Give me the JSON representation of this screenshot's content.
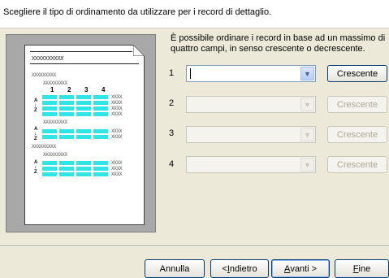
{
  "header": {
    "instruction": "Scegliere il tipo di ordinamento da utilizzare per i record di dettaglio."
  },
  "description": "È possibile ordinare i record in base ad un massimo di quattro campi, in senso crescente o decrescente.",
  "preview": {
    "placeholder_long": "XXXXXXXXXX",
    "placeholder_mid": "XXXXXXXXX",
    "placeholder_short": "XXXXXX",
    "cell_text": "XXXX",
    "column_numbers": [
      "1",
      "2",
      "3",
      "4"
    ],
    "sort_arrow_a": "A",
    "sort_arrow_z": "Z"
  },
  "sort_fields": [
    {
      "number": "1",
      "value": "",
      "enabled": true,
      "direction": "Crescente"
    },
    {
      "number": "2",
      "value": "",
      "enabled": false,
      "direction": "Crescente"
    },
    {
      "number": "3",
      "value": "",
      "enabled": false,
      "direction": "Crescente"
    },
    {
      "number": "4",
      "value": "",
      "enabled": false,
      "direction": "Crescente"
    }
  ],
  "footer": {
    "cancel": "Annulla",
    "back_prefix": "< ",
    "back_accel": "I",
    "back_rest": "ndietro",
    "next_accel": "A",
    "next_rest": "vanti >",
    "finish_accel": "F",
    "finish_rest": "ine"
  },
  "colors": {
    "accent_cell": "#2ee6e6",
    "window_bg": "#ece9d8"
  }
}
